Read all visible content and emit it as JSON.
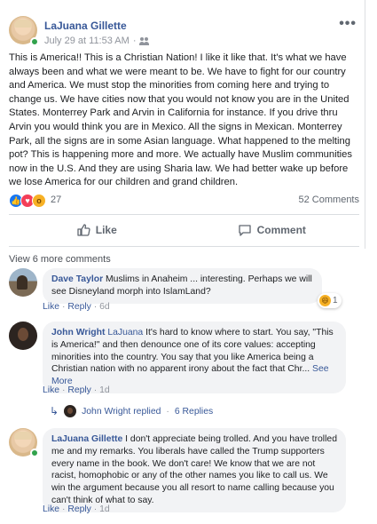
{
  "post": {
    "author": "LaJuana Gillette",
    "timestamp": "July 29 at 11:53 AM",
    "audience_icon": "friends-icon",
    "more_icon": "more-icon",
    "text": "This is America!! This is a Christian Nation! I like it like that. It's what we have always been and what we were meant to be. We have to fight for our country and America. We must stop the minorities from coming here and trying to change us. We have cities now that you would not know you are in the United States. Monterrey Park and Arvin in California for instance. If you drive thru Arvin you would think you are in Mexico. All the signs in Mexican. Monterrey Park, all the signs are in some Asian language. What happened to the melting pot? This is happening more and more. We actually have Muslim communities now in the U.S. And they are using Sharia law. We had better wake up before we lose America for our children and grand children.",
    "reactions": {
      "types": [
        "like",
        "love",
        "wow"
      ],
      "count": "27"
    },
    "comments_count": "52 Comments",
    "actions": {
      "like": "Like",
      "comment": "Comment"
    }
  },
  "comments": {
    "view_more": "View 6 more comments",
    "items": [
      {
        "author": "Dave Taylor",
        "text": "Muslims in Anaheim ... interesting. Perhaps we will see Disneyland morph into IslamLand?",
        "actions": [
          "Like",
          "Reply"
        ],
        "time": "6d",
        "reaction": {
          "type": "haha",
          "count": "1"
        }
      },
      {
        "author": "John Wright",
        "mention": "LaJuana",
        "text": "It's hard to know where to start. You say, \"This is America!\" and then denounce one of its core values: accepting minorities into the country. You say that you like America being a Christian nation with no apparent irony about the fact that Chr...",
        "see_more": "See More",
        "actions": [
          "Like",
          "Reply"
        ],
        "time": "1d",
        "replies": {
          "replier": "John Wright",
          "label": "replied",
          "count": "6 Replies"
        }
      },
      {
        "author": "LaJuana Gillette",
        "text": "I don't appreciate being trolled. And you have trolled me and my remarks. You liberals have called the Trump supporters every name in the book. We don't care! We know that we are not racist, homophobic or any of the other names you like to call us. We win the argument because you all resort to name calling because you can't think of what to say.",
        "actions": [
          "Like",
          "Reply"
        ],
        "time": "1d"
      }
    ]
  },
  "colors": {
    "link": "#385898",
    "meta": "#90949c",
    "bubble": "#f2f3f5",
    "like_blue": "#1877f2",
    "love_red": "#f33e58",
    "wow_yellow": "#f7b125",
    "online_green": "#31a24c"
  }
}
